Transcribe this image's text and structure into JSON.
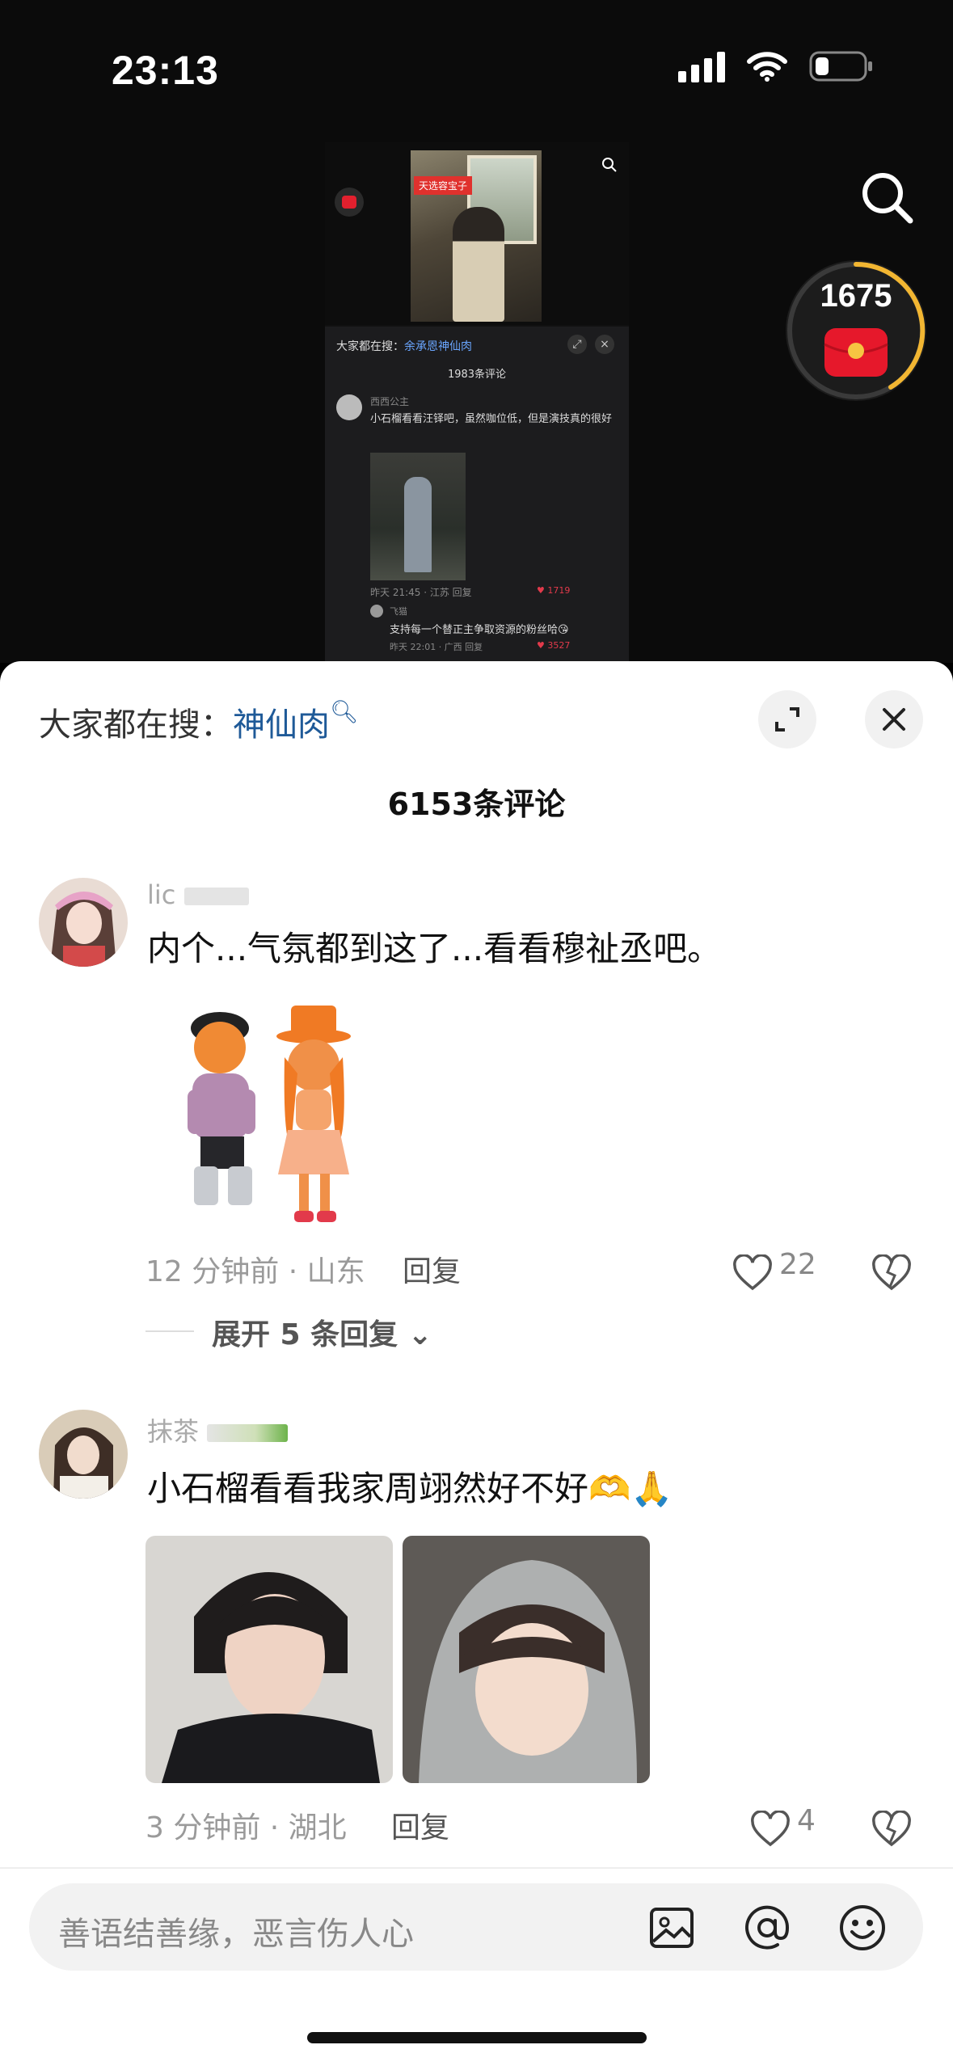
{
  "status": {
    "time": "23:13"
  },
  "redpacket": {
    "count": "1675"
  },
  "mini": {
    "tag": "天选容宝子",
    "search_label": "大家都在搜：",
    "search_kw": "余承恩神仙肉",
    "comment_count": "1983条评论",
    "user": "西西公主",
    "text": "小石榴看看汪铎吧，虽然咖位低，但是演技真的很好",
    "meta": "昨天 21:45 · 江苏    回复",
    "likes": "1719",
    "sub_user": "飞猫",
    "sub_text": "支持每一个替正主争取资源的粉丝哈😘",
    "sub_meta": "昨天 22:01 · 广西    回复",
    "sub_likes": "3527"
  },
  "sheet": {
    "search_label": "大家都在搜：",
    "search_kw": "神仙肉",
    "comment_count": "6153条评论"
  },
  "comments": [
    {
      "username": "lic",
      "text": "内个...气氛都到这了...看看穆祉丞吧。",
      "time_loc": "12 分钟前 · 山东",
      "reply": "回复",
      "likes": "22",
      "expand": "展开 5 条回复"
    },
    {
      "username": "抹茶",
      "text": "小石榴看看我家周翊然好不好🫶🙏",
      "time_loc": "3 分钟前 · 湖北",
      "reply": "回复",
      "likes": "4"
    }
  ],
  "input": {
    "placeholder": "善语结善缘，恶言伤人心"
  },
  "colors": {
    "accent_link": "#1f5a98",
    "like_red": "#e23a4b",
    "sheet_bg": "#ffffff",
    "video_bg": "#0b0b0b"
  }
}
